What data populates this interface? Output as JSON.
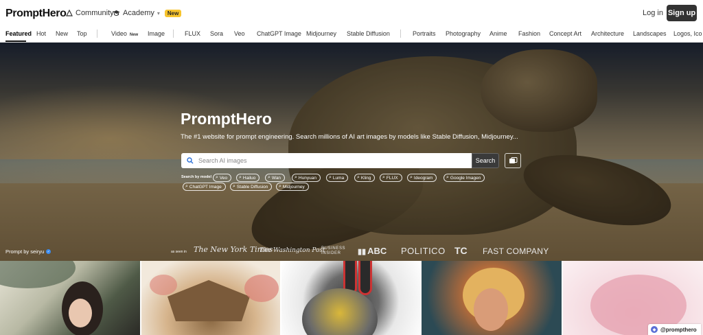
{
  "header": {
    "logo": "PromptHero",
    "community_label": "Community",
    "academy_label": "Academy",
    "academy_badge": "New",
    "login_label": "Log in",
    "signup_label": "Sign up"
  },
  "nav": {
    "featured": "Featured",
    "hot": "Hot",
    "new": "New",
    "top": "Top",
    "video": "Video",
    "video_badge": "New",
    "image": "Image",
    "flux": "FLUX",
    "sora": "Sora",
    "veo": "Veo",
    "chatgpt_image": "ChatGPT Image",
    "midjourney": "Midjourney",
    "stable_diffusion": "Stable Diffusion",
    "portraits": "Portraits",
    "photography": "Photography",
    "anime": "Anime",
    "fashion": "Fashion",
    "concept_art": "Concept Art",
    "architecture": "Architecture",
    "landscapes": "Landscapes",
    "logos": "Logos, Ico"
  },
  "hero": {
    "title": "PromptHero",
    "subtitle": "The #1 website for prompt engineering. Search millions of AI art images by models like Stable Diffusion, Midjourney...",
    "search_placeholder": "Search AI images",
    "search_button": "Search",
    "model_label": "Search by model",
    "models": [
      "Veo",
      "Hailuo",
      "Wan",
      "Hunyuan",
      "Luma",
      "Kling",
      "FLUX",
      "Ideogram",
      "Google Imagen",
      "ChatGPT Image",
      "Stable Diffusion",
      "Midjourney"
    ],
    "prompt_by": "Prompt by seiryu",
    "as_seen_in": "as seen in",
    "press": {
      "nyt": "The New York Times",
      "wp": "The Washington Post",
      "bi": "BUSINESS INSIDER",
      "abc": "ABC",
      "politico": "POLITICO",
      "tc": "TC",
      "fc": "FAST COMPANY"
    }
  },
  "watermark": "@prompthero",
  "colors": {
    "signup_bg": "#333333",
    "new_badge": "#f7c42d",
    "verified": "#3b8cf0"
  }
}
